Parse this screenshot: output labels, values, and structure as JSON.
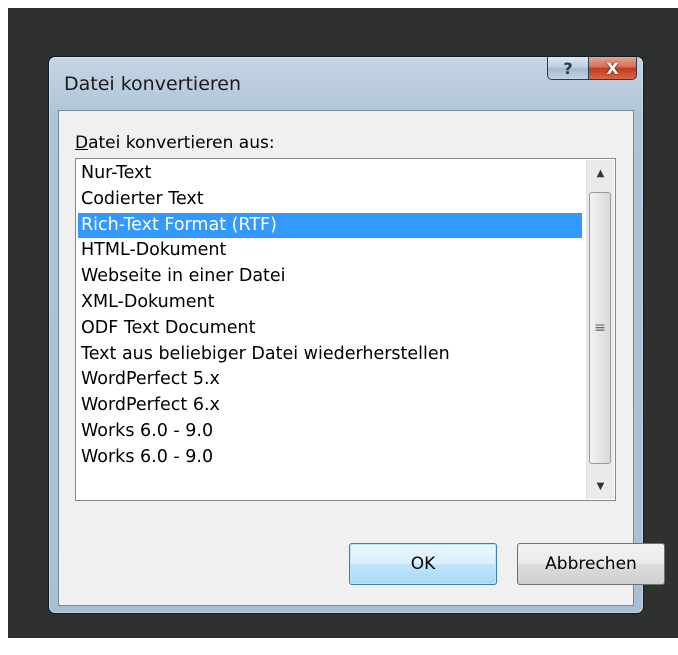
{
  "dialog": {
    "title": "Datei konvertieren",
    "help_label": "?",
    "close_label": "X"
  },
  "list": {
    "label_access": "D",
    "label_rest": "atei konvertieren aus:",
    "selected_index": 2,
    "items": [
      "Nur-Text",
      "Codierter Text",
      "Rich-Text Format (RTF)",
      "HTML-Dokument",
      "Webseite in einer Datei",
      "XML-Dokument",
      "ODF Text Document",
      "Text aus beliebiger Datei wiederherstellen",
      "WordPerfect 5.x",
      "WordPerfect 6.x",
      "Works 6.0 - 9.0",
      "Works 6.0 - 9.0"
    ]
  },
  "scrollbar": {
    "up_icon": "▲",
    "down_icon": "▼",
    "grip_icon": "≡"
  },
  "buttons": {
    "ok": "OK",
    "cancel": "Abbrechen"
  }
}
